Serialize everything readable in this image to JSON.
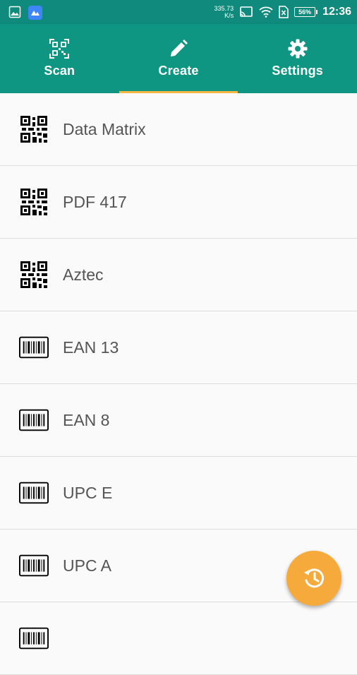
{
  "status_bar": {
    "net_speed_value": "335.73",
    "net_speed_unit": "K/s",
    "battery": "56%",
    "time": "12:36",
    "left_icons": [
      "gallery-icon",
      "app-icon"
    ],
    "right_icons": [
      "cast-icon",
      "wifi-icon",
      "sim-icon",
      "battery-icon"
    ]
  },
  "tabs": [
    {
      "label": "Scan",
      "icon": "qr-scan-icon",
      "selected": false
    },
    {
      "label": "Create",
      "icon": "pencil-icon",
      "selected": true
    },
    {
      "label": "Settings",
      "icon": "gear-icon",
      "selected": false
    }
  ],
  "list": {
    "items": [
      {
        "label": "Data Matrix",
        "icon": "qr-code-icon"
      },
      {
        "label": "PDF 417",
        "icon": "qr-code-icon"
      },
      {
        "label": "Aztec",
        "icon": "qr-code-icon"
      },
      {
        "label": "EAN 13",
        "icon": "barcode-icon"
      },
      {
        "label": "EAN 8",
        "icon": "barcode-icon"
      },
      {
        "label": "UPC E",
        "icon": "barcode-icon"
      },
      {
        "label": "UPC A",
        "icon": "barcode-icon"
      },
      {
        "label": "",
        "icon": "barcode-icon"
      }
    ]
  },
  "fab": {
    "icon": "history-icon"
  },
  "colors": {
    "status_bar": "#0f8a7c",
    "app_bar": "#0f9682",
    "tab_indicator": "#f5b642",
    "fab": "#f7aa3c",
    "list_bg": "#fafafa",
    "list_text": "#555555",
    "divider": "#dddddd"
  }
}
